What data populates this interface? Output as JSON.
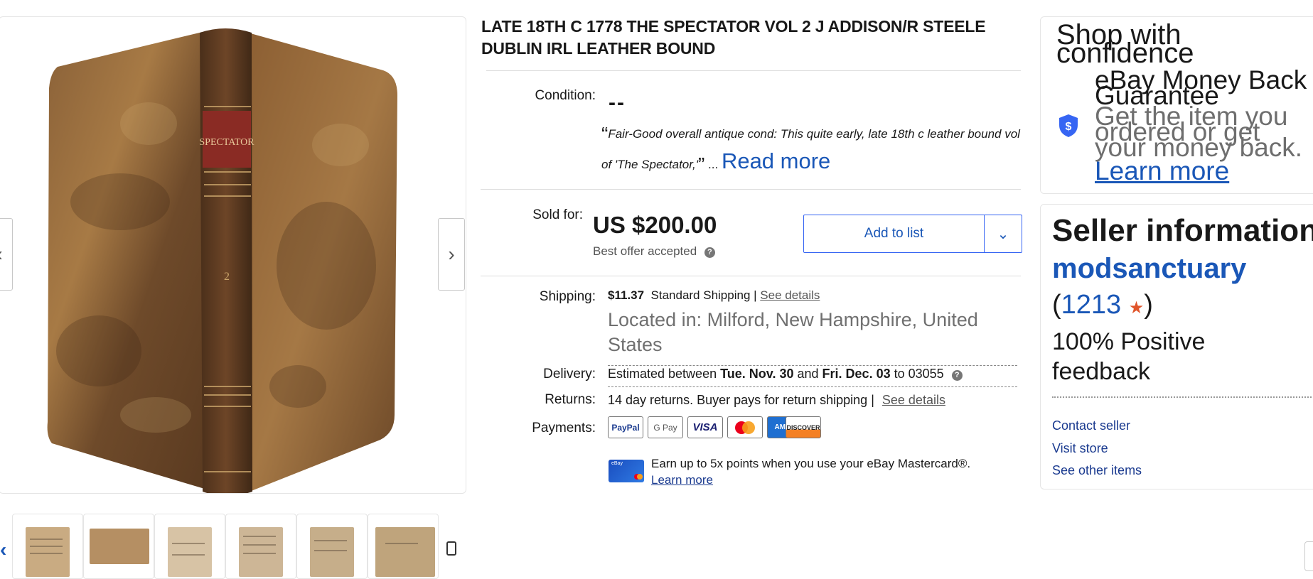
{
  "title": "LATE 18TH C 1778 THE SPECTATOR VOL 2 J ADDISON/R STEELE DUBLIN IRL LEATHER BOUND",
  "condition": {
    "label": "Condition:",
    "value": "--",
    "quote": "Fair-Good overall antique cond: This quite early, late 18th c leather bound vol of 'The Spectator,'",
    "ellipsis": "...",
    "read_more": "Read more"
  },
  "price": {
    "label": "Sold for:",
    "value": "US $200.00",
    "note": "Best offer accepted",
    "help_glyph": "?"
  },
  "add_to_list": {
    "label": "Add to list",
    "dropdown_glyph": "⌄"
  },
  "shipping": {
    "label": "Shipping:",
    "cost": "$11.37",
    "method": "Standard Shipping |",
    "details_link": "See details",
    "location": "Located in: Milford, New Hampshire, United States"
  },
  "delivery": {
    "label": "Delivery:",
    "prefix": "Estimated between",
    "start": "Tue. Nov. 30",
    "and": "and",
    "end": "Fri. Dec. 03",
    "to": "to 03055"
  },
  "returns": {
    "label": "Returns:",
    "text": "14 day returns. Buyer pays for return shipping |",
    "details_link": "See details"
  },
  "payments": {
    "label": "Payments:",
    "methods": [
      "PayPal",
      "G Pay",
      "VISA",
      "Mastercard",
      "AMEX",
      "DISCOVER"
    ]
  },
  "mastercard_promo": {
    "card_label": "eBay",
    "text": "Earn up to 5x points when you use your eBay Mastercard®.",
    "link": "Learn more"
  },
  "shop_confidence": {
    "heading": "Shop with confidence",
    "guarantee_title": "eBay Money Back Guarantee",
    "guarantee_text": "Get the item you ordered or get your money back.",
    "link": "Learn more",
    "shield_glyph": "$"
  },
  "seller": {
    "heading": "Seller information",
    "name": "modsanctuary",
    "score_open": "(",
    "score": "1213",
    "score_close": ")",
    "feedback": "100% Positive feedback",
    "links": [
      "Contact seller",
      "Visit store",
      "See other items"
    ]
  },
  "gallery": {
    "prev_glyph": "‹",
    "next_glyph": "›",
    "spine_label": "SPECTATOR",
    "volume_number": "2"
  },
  "colors": {
    "link_blue": "#1a57b7",
    "button_border": "#3665f3",
    "shield": "#3665f3",
    "star": "#e0552b"
  }
}
